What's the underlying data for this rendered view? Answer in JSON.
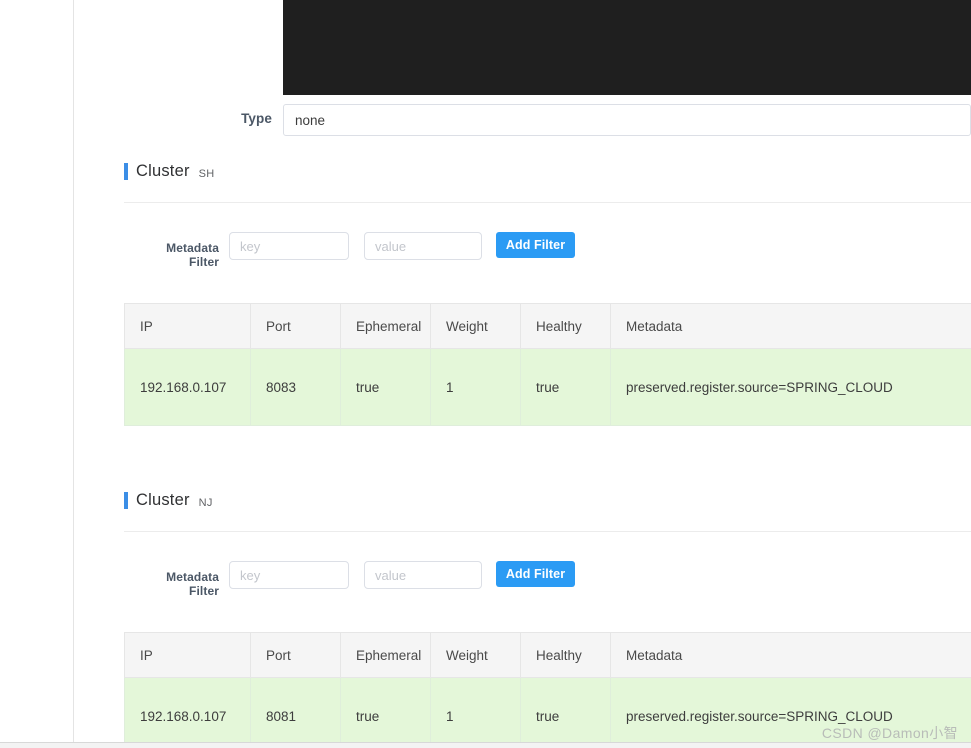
{
  "form": {
    "type_label": "Type",
    "type_value": "none"
  },
  "colors": {
    "accent_blue": "#3b8ee6",
    "button_blue": "#2b9bf4",
    "row_green": "#e4f7d9",
    "header_gray": "#f5f5f5",
    "redacted_black": "#1f1f1f"
  },
  "filter": {
    "label": "Metadata Filter",
    "key_placeholder": "key",
    "key_value": "",
    "value_placeholder": "value",
    "value_value": "",
    "add_button": "Add Filter"
  },
  "table_columns": [
    "IP",
    "Port",
    "Ephemeral",
    "Weight",
    "Healthy",
    "Metadata"
  ],
  "clusters": [
    {
      "title": "Cluster",
      "name": "SH",
      "rows": [
        {
          "ip": "192.168.0.107",
          "port": "8083",
          "ephemeral": "true",
          "weight": "1",
          "healthy": "true",
          "metadata": "preserved.register.source=SPRING_CLOUD"
        }
      ]
    },
    {
      "title": "Cluster",
      "name": "NJ",
      "rows": [
        {
          "ip": "192.168.0.107",
          "port": "8081",
          "ephemeral": "true",
          "weight": "1",
          "healthy": "true",
          "metadata": "preserved.register.source=SPRING_CLOUD"
        }
      ]
    }
  ],
  "watermark": "CSDN @Damon小智"
}
